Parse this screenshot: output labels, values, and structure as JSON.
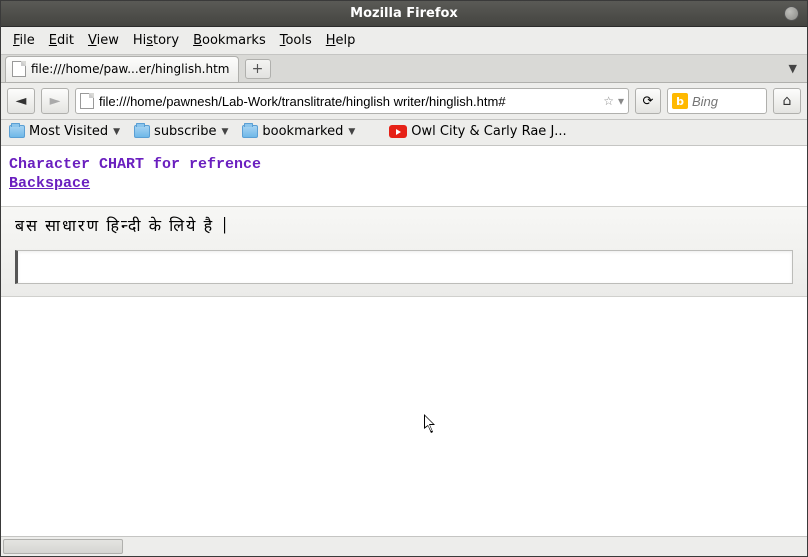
{
  "window": {
    "title": "Mozilla Firefox"
  },
  "menubar": {
    "items": [
      "File",
      "Edit",
      "View",
      "History",
      "Bookmarks",
      "Tools",
      "Help"
    ]
  },
  "tabs": {
    "active_label": "file:///home/paw...er/hinglish.htm",
    "newtab_label": "+"
  },
  "navbar": {
    "url": "file:///home/pawnesh/Lab-Work/translitrate/hinglish writer/hinglish.htm#",
    "star_icon": "☆",
    "dropdown_icon": "▾",
    "back_icon": "◄",
    "forward_icon": "►",
    "reload_icon": "⟳",
    "home_icon": "⌂",
    "search_engine_label": "b",
    "search_placeholder": "Bing"
  },
  "bookmarks": {
    "most_visited": "Most Visited",
    "subscribe": "subscribe",
    "bookmarked": "bookmarked",
    "video": "Owl City & Carly Rae J..."
  },
  "page": {
    "heading": "Character CHART for refrence",
    "backspace": "Backspace",
    "hindi_text": "बस  साधारण  हिन्दी  के  लिये  है  |"
  }
}
